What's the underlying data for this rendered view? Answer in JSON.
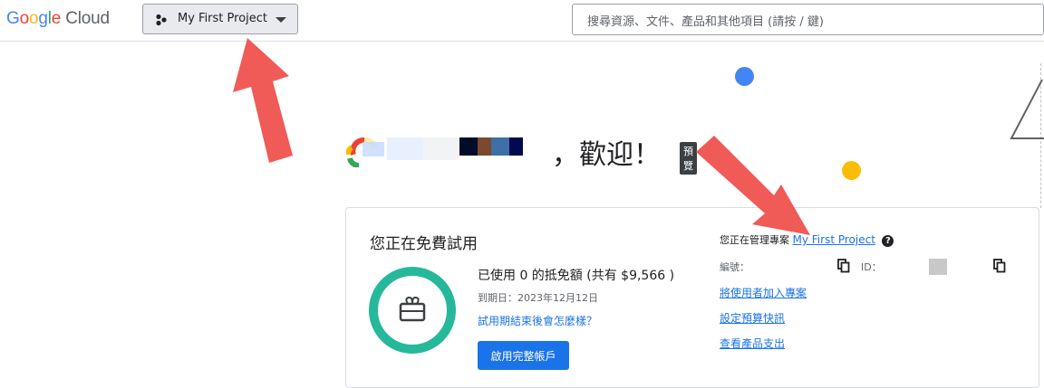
{
  "header": {
    "logo": {
      "g1": "G",
      "g2": "o",
      "g3": "o",
      "g4": "g",
      "g5": "l",
      "g6": "e",
      "cloud": " Cloud"
    },
    "project_picker_label": "My First Project",
    "search_placeholder": "搜尋資源、文件、產品和其他項目 (請按 / 鍵)"
  },
  "welcome": {
    "title": "，歡迎！",
    "badge": "預覽"
  },
  "trial_card": {
    "title": "您正在免費試用",
    "used_text": "已使用 0 的抵免額 (共有 $9,566 )",
    "end_date": "到期日：2023年12月12日",
    "after_link": "試用期結束後會怎麼樣？",
    "activate_button": "啟用完整帳戶"
  },
  "project_info": {
    "managing_prefix": "您正在管理專案",
    "project_link": "My First Project",
    "number_label": "編號：",
    "id_label": "ID："
  },
  "links": [
    "將使用者加入專案",
    "設定預算快訊",
    "查看產品支出"
  ],
  "colors": {
    "accent": "#1a73e8",
    "arrow": "#f05a57",
    "ring": "#26b89a"
  }
}
